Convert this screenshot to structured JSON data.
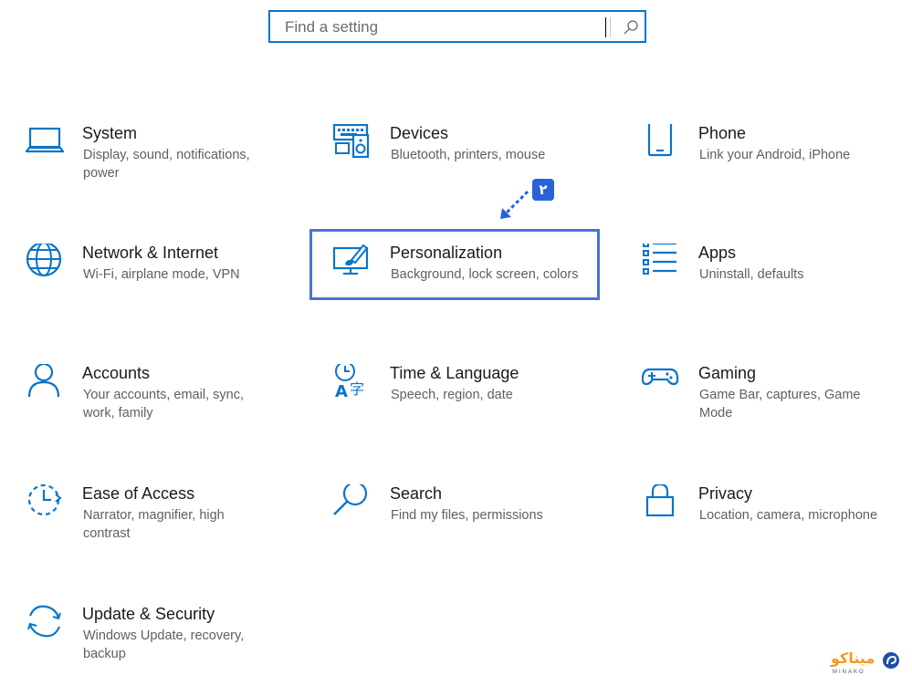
{
  "search": {
    "placeholder": "Find a setting"
  },
  "tiles": [
    {
      "title": "System",
      "desc": "Display, sound, notifications, power",
      "icon": "laptop-icon"
    },
    {
      "title": "Devices",
      "desc": "Bluetooth, printers, mouse",
      "icon": "devices-icon"
    },
    {
      "title": "Phone",
      "desc": "Link your Android, iPhone",
      "icon": "phone-icon"
    },
    {
      "title": "Network & Internet",
      "desc": "Wi-Fi, airplane mode, VPN",
      "icon": "globe-icon"
    },
    {
      "title": "Personalization",
      "desc": "Background, lock screen, colors",
      "icon": "personalization-icon"
    },
    {
      "title": "Apps",
      "desc": "Uninstall, defaults",
      "icon": "apps-list-icon"
    },
    {
      "title": "Accounts",
      "desc": "Your accounts, email, sync, work, family",
      "icon": "person-icon"
    },
    {
      "title": "Time & Language",
      "desc": "Speech, region, date",
      "icon": "time-language-icon"
    },
    {
      "title": "Gaming",
      "desc": "Game Bar, captures, Game Mode",
      "icon": "gamepad-icon"
    },
    {
      "title": "Ease of Access",
      "desc": "Narrator, magnifier, high contrast",
      "icon": "ease-of-access-icon"
    },
    {
      "title": "Search",
      "desc": "Find my files, permissions",
      "icon": "magnifier-icon"
    },
    {
      "title": "Privacy",
      "desc": "Location, camera, microphone",
      "icon": "lock-icon"
    },
    {
      "title": "Update & Security",
      "desc": "Windows Update, recovery, backup",
      "icon": "sync-icon"
    }
  ],
  "annotation": {
    "badge": "۲"
  },
  "watermark": {
    "brand": "میناکو",
    "sub": "MINAKO"
  },
  "colors": {
    "accent": "#0a74c9",
    "highlight": "#4b73d6"
  }
}
